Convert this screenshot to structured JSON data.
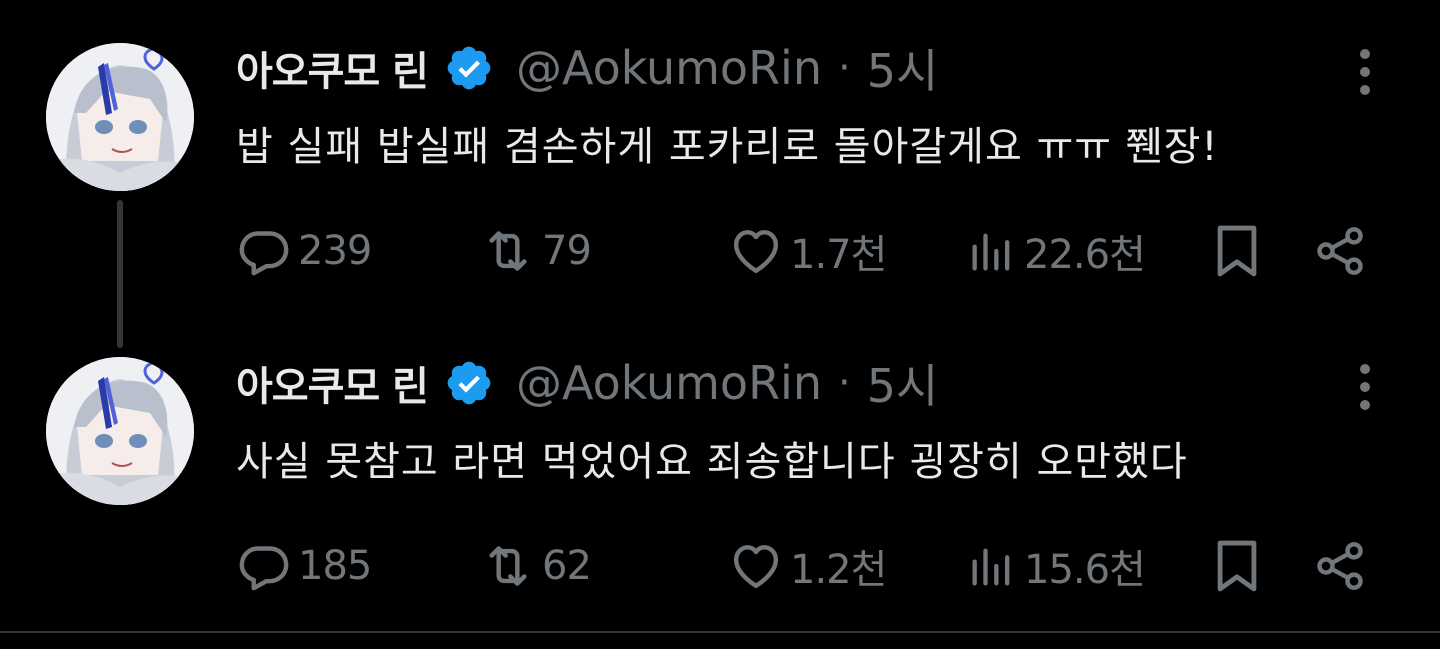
{
  "colors": {
    "background": "#000000",
    "text": "#e7e9ea",
    "secondary": "#71767b",
    "verified": "#1d9bf0"
  },
  "tweets": [
    {
      "display_name": "아오쿠모 린",
      "handle": "@AokumoRin",
      "separator": "·",
      "time": "5시",
      "text": "밥 실패 밥실패 겸손하게 포카리로 돌아갈게요 ㅠㅠ 쮄장!",
      "replies": "239",
      "retweets": "79",
      "likes": "1.7천",
      "views": "22.6천"
    },
    {
      "display_name": "아오쿠모 린",
      "handle": "@AokumoRin",
      "separator": "·",
      "time": "5시",
      "text": "사실 못참고 라면 먹었어요 죄송합니다 굉장히 오만했다",
      "replies": "185",
      "retweets": "62",
      "likes": "1.2천",
      "views": "15.6천"
    }
  ]
}
